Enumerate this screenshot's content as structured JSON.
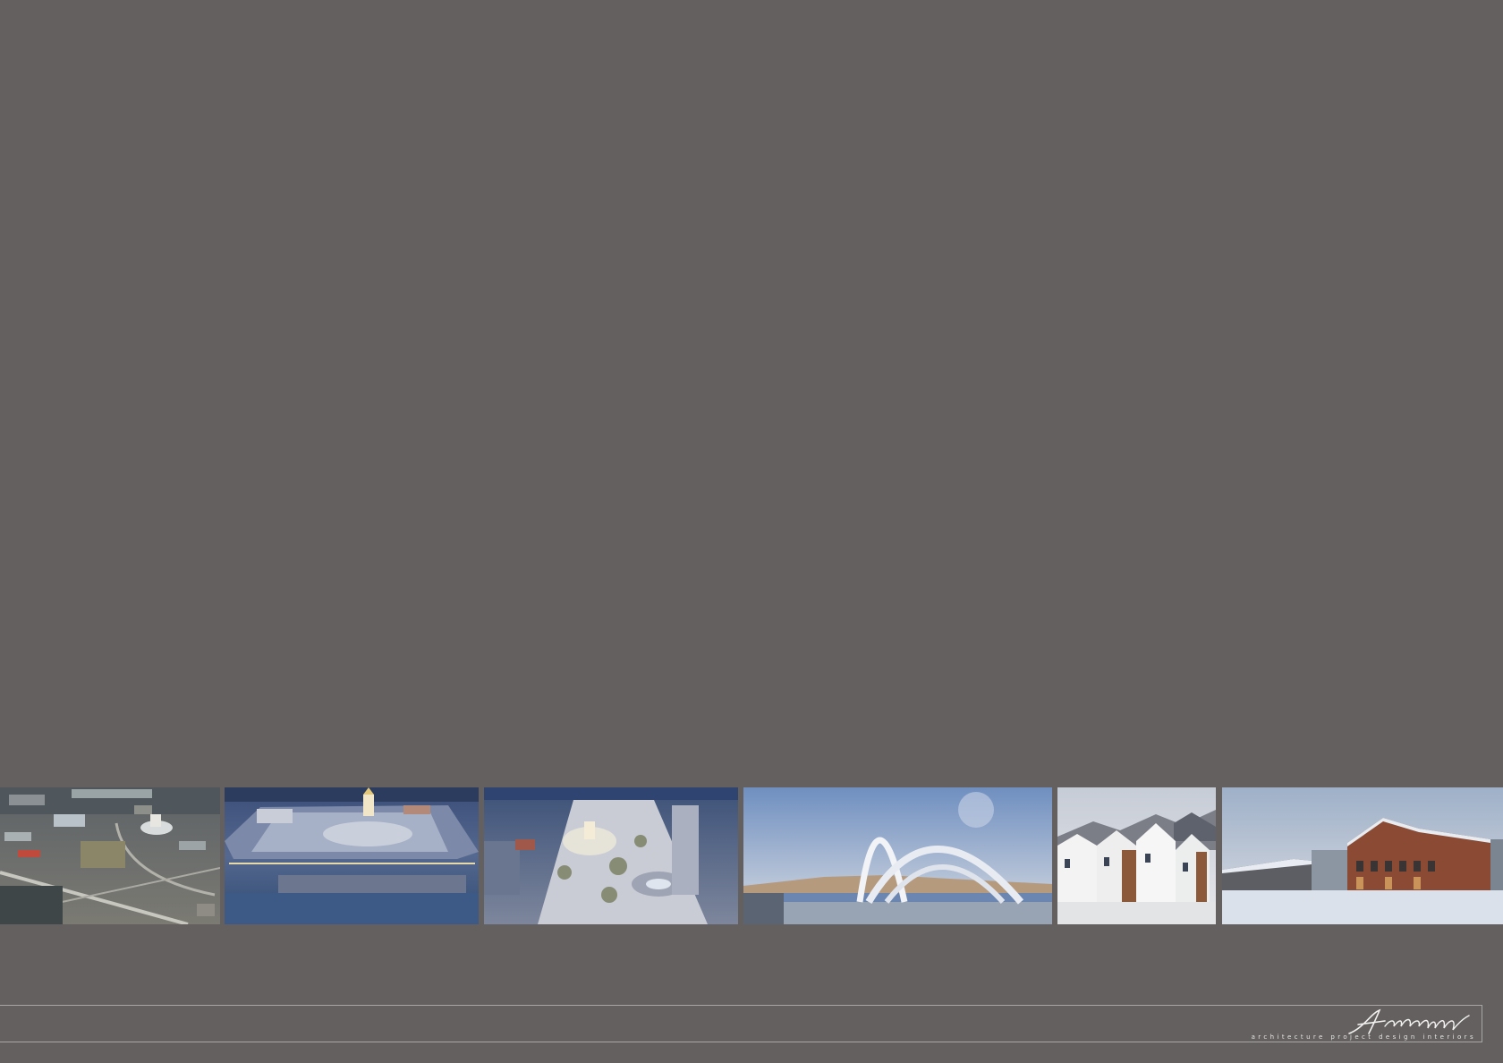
{
  "colors": {
    "background": "#646060",
    "rule": "#a9a6a6",
    "logo": "#f2f0f0"
  },
  "gallery": [
    {
      "name": "aerial-town-photo",
      "alt": "aerial town view"
    },
    {
      "name": "night-square-render-1",
      "alt": "night square render"
    },
    {
      "name": "night-square-render-2",
      "alt": "night square render top view"
    },
    {
      "name": "arches-render",
      "alt": "white arches monument"
    },
    {
      "name": "townhouses-render",
      "alt": "white townhouses"
    },
    {
      "name": "brick-building-render",
      "alt": "brick building in snow"
    }
  ],
  "logo": {
    "signature": "Archigraph",
    "tagline": "architecture  project  design  interiors"
  }
}
